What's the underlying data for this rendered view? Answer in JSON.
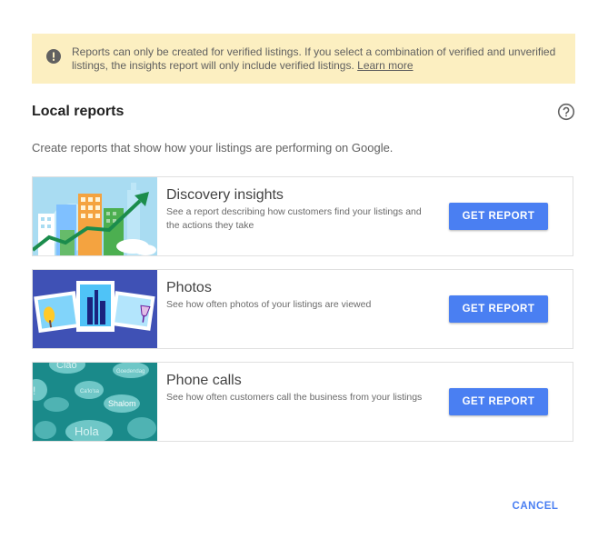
{
  "banner": {
    "message": "Reports can only be created for verified listings. If you select a combination of verified and unverified listings, the insights report will only include verified listings.",
    "link": "Learn more",
    "icon": "alert-icon"
  },
  "header": {
    "title": "Local reports",
    "help_icon": "help-circle-icon"
  },
  "intro": "Create reports that show how your listings are performing on Google.",
  "reports": [
    {
      "title": "Discovery insights",
      "description": "See a report describing how customers find your listings and the actions they take",
      "button": "GET REPORT",
      "image": "city-growth-illustration"
    },
    {
      "title": "Photos",
      "description": "See how often photos of your listings are viewed",
      "button": "GET REPORT",
      "image": "photos-illustration"
    },
    {
      "title": "Phone calls",
      "description": "See how often customers call the business from your listings",
      "button": "GET REPORT",
      "image": "speech-bubbles-illustration",
      "bubbles": [
        "Ciao",
        "Goedendag",
        "Shalom",
        "Hola",
        "Ca'lo'sa",
        "!"
      ]
    }
  ],
  "footer": {
    "cancel": "CANCEL"
  },
  "colors": {
    "accent": "#4a7ff2",
    "warning_bg": "#fcefc1",
    "photos_bg": "#3f51b5",
    "calls_bg": "#1a8a8a"
  }
}
